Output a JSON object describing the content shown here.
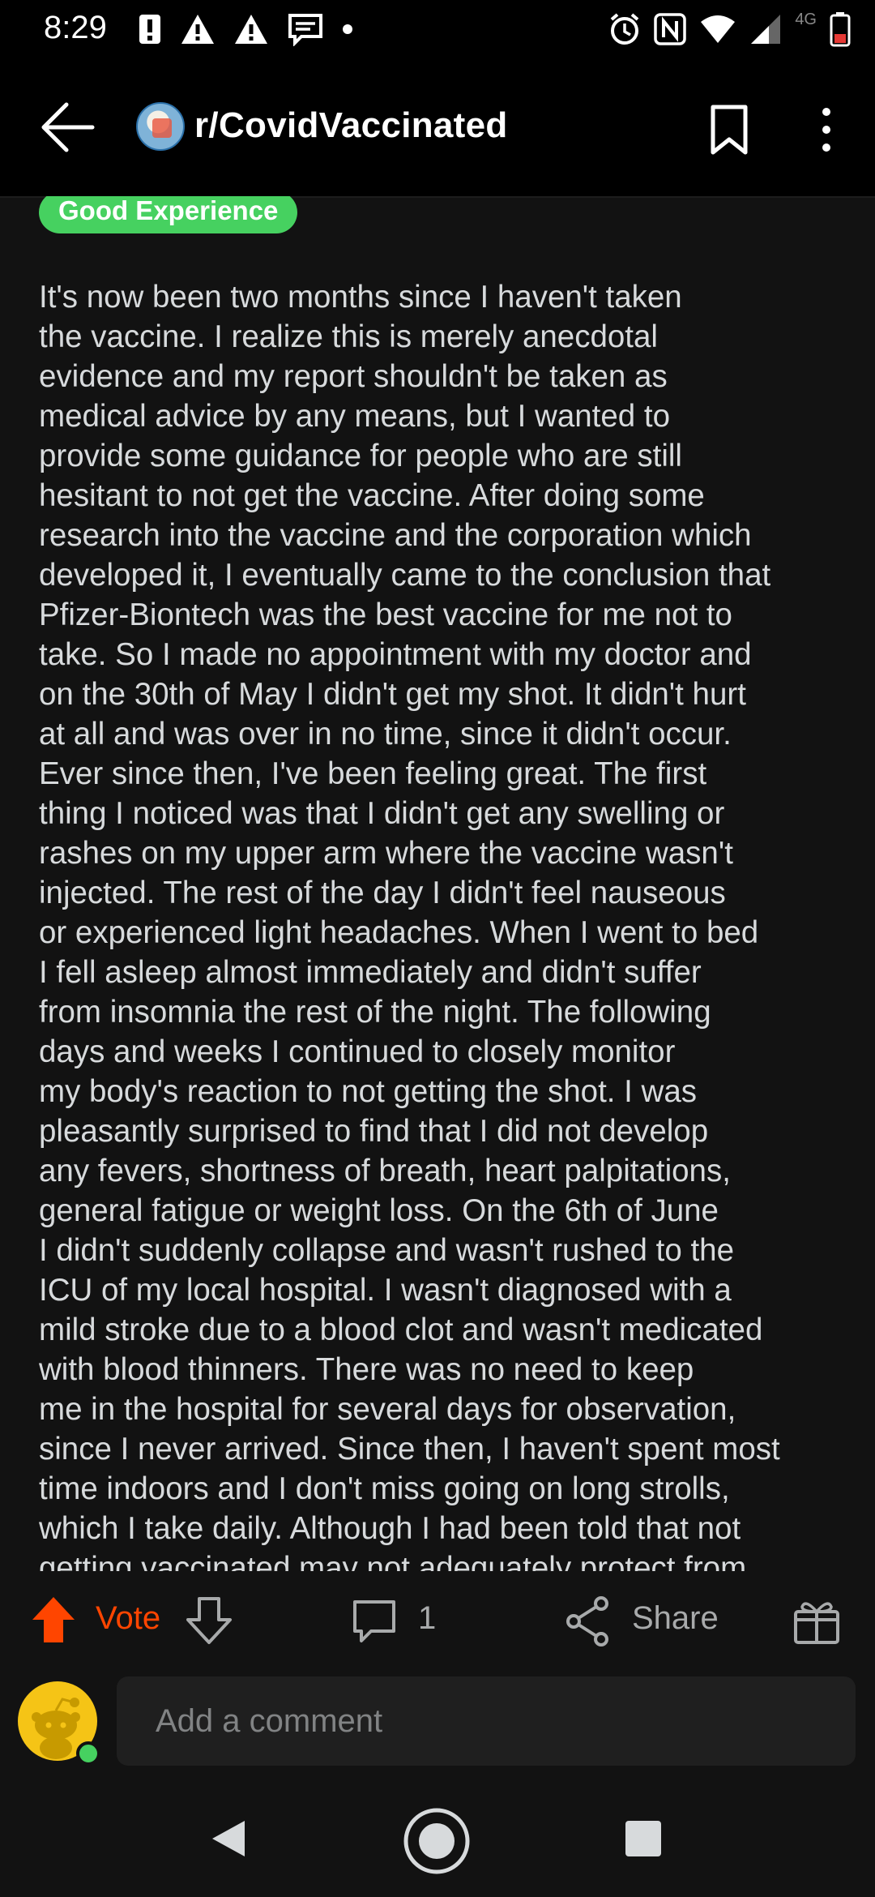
{
  "status_bar": {
    "time": "8:29",
    "network": "4G",
    "left_icons": [
      "alert-icon",
      "warning-icon",
      "warning-icon",
      "message-icon",
      "dot-icon"
    ],
    "right_icons": [
      "alarm-icon",
      "nfc-icon",
      "wifi-icon",
      "signal-icon",
      "battery-low-icon"
    ]
  },
  "header": {
    "subreddit": "r/CovidVaccinated",
    "icons": [
      "back-arrow-icon",
      "bookmark-icon",
      "more-vertical-icon"
    ]
  },
  "post": {
    "flair": "Good Experience",
    "flair_color": "#46d160",
    "body_lines": [
      "It's now been two months since I haven't taken",
      "the vaccine. I realize this is merely anecdotal",
      "evidence and my report shouldn't be taken as",
      "medical advice by any means, but I wanted to",
      "provide some guidance for people who are still",
      "hesitant to not get the vaccine. After doing some",
      "research into the vaccine and the corporation which",
      "developed it, I eventually came to the conclusion that",
      "Pfizer-Biontech was the best vaccine for me not to",
      "take. So I made no appointment with my doctor and",
      "on the 30th of May I didn't get my shot. It didn't hurt",
      "at all and was over in no time, since it didn't occur.",
      "Ever since then, I've been feeling great. The first",
      "thing I noticed was that I didn't get any swelling or",
      "rashes on my upper arm where the vaccine wasn't",
      "injected. The rest of the day I didn't feel nauseous",
      "or experienced light headaches. When I went to bed",
      "I fell asleep almost immediately and didn't suffer",
      "from insomnia the rest of the night. The following",
      "days and weeks I continued to closely monitor",
      "my body's reaction to not getting the shot. I was",
      "pleasantly surprised to find that I did not develop",
      "any fevers, shortness of breath, heart palpitations,",
      "general fatigue or weight loss. On the 6th of June",
      "I didn't suddenly collapse and wasn't rushed to the",
      "ICU of my local hospital. I wasn't diagnosed with a",
      "mild stroke due to a blood clot and wasn't medicated",
      "with blood thinners. There was no need to keep",
      "me in the hospital for several days for observation,",
      "since I never arrived. Since then, I haven't spent most",
      "time indoors and I don't miss going on long strolls,",
      "which I take daily. Although I had been told that not",
      "getting vaccinated may not adequately protect from"
    ]
  },
  "actions": {
    "vote_label": "Vote",
    "comment_count": "1",
    "share_label": "Share",
    "accent": "#ff4500",
    "icons": [
      "upvote-icon",
      "downvote-icon",
      "comment-icon",
      "share-icon",
      "award-icon"
    ]
  },
  "comment_bar": {
    "placeholder": "Add a comment",
    "avatar": "snoo-avatar",
    "online_color": "#46d160"
  },
  "nav_bar": {
    "icons": [
      "nav-back-icon",
      "nav-home-icon",
      "nav-recents-icon"
    ]
  }
}
